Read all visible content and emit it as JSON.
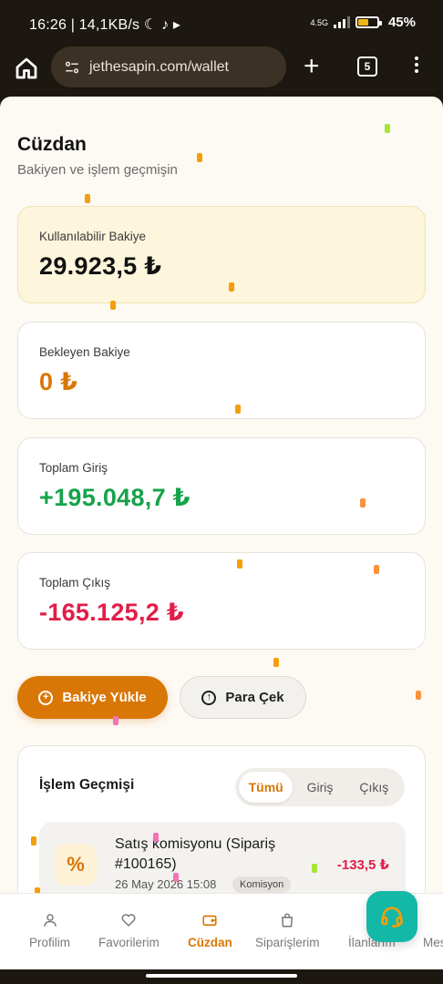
{
  "status_bar": {
    "time": "16:26",
    "speed": "14,1KB/s",
    "network": "4.5G",
    "battery": "45%"
  },
  "browser": {
    "url": "jethesapin.com/wallet",
    "tab_count": "5"
  },
  "page": {
    "title": "Cüzdan",
    "subtitle": "Bakiyen ve işlem geçmişin"
  },
  "balances": {
    "available": {
      "label": "Kullanılabilir Bakiye",
      "value": "29.923,5 ₺"
    },
    "pending": {
      "label": "Bekleyen Bakiye",
      "value": "0 ₺"
    },
    "total_in": {
      "label": "Toplam Giriş",
      "value": "+195.048,7 ₺"
    },
    "total_out": {
      "label": "Toplam Çıkış",
      "value": "-165.125,2 ₺"
    }
  },
  "actions": {
    "deposit": "Bakiye Yükle",
    "withdraw": "Para Çek"
  },
  "history": {
    "title": "İşlem Geçmişi",
    "filters": [
      "Tümü",
      "Giriş",
      "Çıkış"
    ],
    "active_filter": "Tümü",
    "transactions": [
      {
        "title": "Satış komisyonu (Sipariş #100165)",
        "date": "26 May 2026 15:08",
        "badge": "Komisyon",
        "amount": "-133,5 ₺",
        "icon": "percent-icon"
      }
    ]
  },
  "bottom_nav": {
    "items": [
      "Profilim",
      "Favorilerim",
      "Cüzdan",
      "Siparişlerim",
      "İlanlarım",
      "Mes"
    ],
    "active": "Cüzdan"
  },
  "colors": {
    "accent": "#d97706",
    "positive": "#16a34a",
    "negative": "#e11d48",
    "support_fab": "#14b8a6"
  }
}
